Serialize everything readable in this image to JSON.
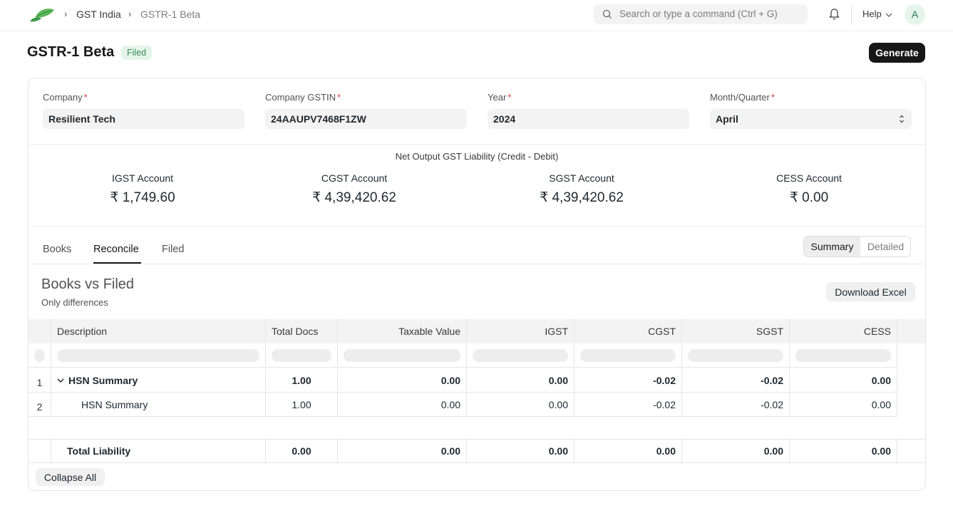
{
  "nav": {
    "breadcrumbs": [
      "GST India",
      "GSTR-1 Beta"
    ],
    "search_placeholder": "Search or type a command (Ctrl + G)",
    "help_label": "Help",
    "avatar_initial": "A"
  },
  "page": {
    "title": "GSTR-1 Beta",
    "status_badge": "Filed",
    "generate_label": "Generate"
  },
  "filters": {
    "company": {
      "label": "Company",
      "value": "Resilient Tech"
    },
    "gstin": {
      "label": "Company GSTIN",
      "value": "24AAUPV7468F1ZW"
    },
    "year": {
      "label": "Year",
      "value": "2024"
    },
    "period": {
      "label": "Month/Quarter",
      "value": "April"
    },
    "required_mark": "*"
  },
  "liability": {
    "title": "Net Output GST Liability (Credit - Debit)",
    "accounts": [
      {
        "label": "IGST Account",
        "value": "₹ 1,749.60"
      },
      {
        "label": "CGST Account",
        "value": "₹ 4,39,420.62"
      },
      {
        "label": "SGST Account",
        "value": "₹ 4,39,420.62"
      },
      {
        "label": "CESS Account",
        "value": "₹ 0.00"
      }
    ]
  },
  "tabs": [
    "Books",
    "Reconcile",
    "Filed"
  ],
  "active_tab": "Reconcile",
  "view_toggle": [
    "Summary",
    "Detailed"
  ],
  "reconcile": {
    "title": "Books vs Filed",
    "subtitle": "Only differences",
    "download_label": "Download Excel"
  },
  "table": {
    "columns": [
      "Description",
      "Total Docs",
      "Taxable Value",
      "IGST",
      "CGST",
      "SGST",
      "CESS"
    ],
    "rows": [
      {
        "index": "1",
        "description": "HSN Summary",
        "total_docs": "1.00",
        "taxable_value": "0.00",
        "igst": "0.00",
        "cgst": "-0.02",
        "sgst": "-0.02",
        "cess": "0.00"
      },
      {
        "index": "2",
        "description": "HSN Summary",
        "total_docs": "1.00",
        "taxable_value": "0.00",
        "igst": "0.00",
        "cgst": "-0.02",
        "sgst": "-0.02",
        "cess": "0.00"
      }
    ],
    "total": {
      "description": "Total Liability",
      "total_docs": "0.00",
      "taxable_value": "0.00",
      "igst": "0.00",
      "cgst": "0.00",
      "sgst": "0.00",
      "cess": "0.00"
    },
    "collapse_label": "Collapse All"
  }
}
